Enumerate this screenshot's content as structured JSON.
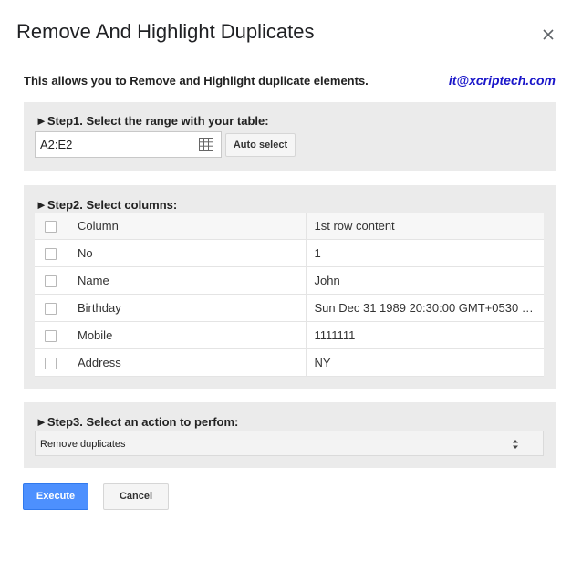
{
  "dialog": {
    "title": "Remove And Highlight Duplicates",
    "intro": "This allows you to Remove and Highlight duplicate elements.",
    "email": "it@xcriptech.com"
  },
  "step1": {
    "title": "►Step1. Select the range with your table:",
    "range_value": "A2:E2",
    "auto_select_label": "Auto select"
  },
  "step2": {
    "title": "►Step2. Select columns:",
    "header": {
      "column": "Column",
      "content": "1st row content"
    },
    "rows": [
      {
        "column": "No",
        "content": "1",
        "checked": false
      },
      {
        "column": "Name",
        "content": "John",
        "checked": false
      },
      {
        "column": "Birthday",
        "content": "Sun Dec 31 1989 20:30:00 GMT+0530 …",
        "checked": false
      },
      {
        "column": "Mobile",
        "content": "1111111",
        "checked": false
      },
      {
        "column": "Address",
        "content": "NY",
        "checked": false
      }
    ]
  },
  "step3": {
    "title": "►Step3. Select an action to perfom:",
    "selected_action": "Remove duplicates"
  },
  "buttons": {
    "execute": "Execute",
    "cancel": "Cancel"
  },
  "colors": {
    "accent": "#4d90fe",
    "email": "#1a16c9",
    "panel": "#ebebeb"
  }
}
